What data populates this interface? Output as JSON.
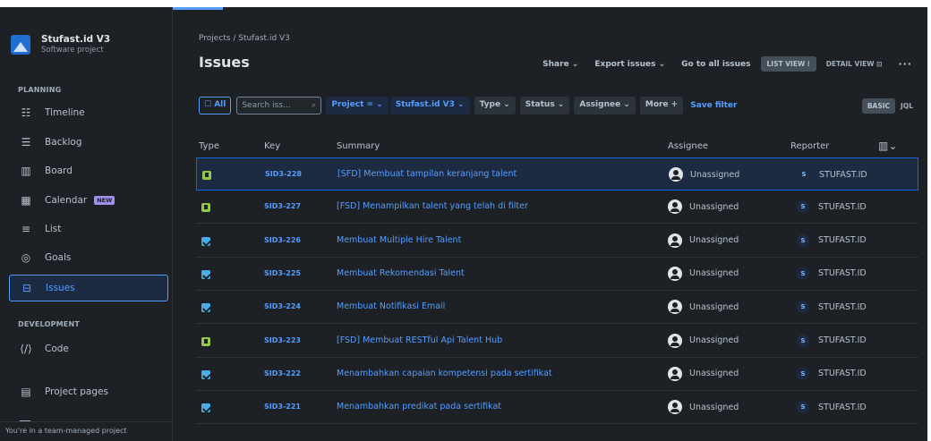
{
  "sidebar": {
    "project_name": "Stufast.id V3",
    "project_type": "Software project",
    "planning_label": "PLANNING",
    "development_label": "DEVELOPMENT",
    "items": [
      {
        "label": "Timeline",
        "icon": "timeline-icon"
      },
      {
        "label": "Backlog",
        "icon": "backlog-icon"
      },
      {
        "label": "Board",
        "icon": "board-icon"
      },
      {
        "label": "Calendar",
        "icon": "calendar-icon",
        "badge": "NEW"
      },
      {
        "label": "List",
        "icon": "list-icon"
      },
      {
        "label": "Goals",
        "icon": "goals-icon"
      },
      {
        "label": "Issues",
        "icon": "issues-icon",
        "active": true
      }
    ],
    "dev_items": [
      {
        "label": "Code",
        "icon": "code-icon"
      }
    ],
    "project_pages": "Project pages",
    "team_note": "You're in a team-managed project"
  },
  "header": {
    "breadcrumb": "Projects / Stufast.id V3",
    "title": "Issues",
    "share": "Share ⌄",
    "export": "Export issues ⌄",
    "go_all": "Go to all issues",
    "list_view": "LIST VIEW ⁝",
    "detail_view": "DETAIL VIEW ⊡",
    "more": "···"
  },
  "filters": {
    "all": "☐ All",
    "search_placeholder": "Search iss...",
    "project": "Project = ⌄",
    "project_value": "Stufast.id V3 ⌄",
    "type": "Type ⌄",
    "status": "Status ⌄",
    "assignee": "Assignee ⌄",
    "more": "More +",
    "save": "Save filter",
    "basic": "BASIC",
    "jql": "JQL"
  },
  "table": {
    "columns": {
      "type": "Type",
      "key": "Key",
      "summary": "Summary",
      "assignee": "Assignee",
      "reporter": "Reporter"
    },
    "rows": [
      {
        "type": "story",
        "key": "SID3-228",
        "summary": "[SFD] Membuat tampilan keranjang talent",
        "assignee": "Unassigned",
        "reporter": "STUFAST.ID",
        "selected": true
      },
      {
        "type": "story",
        "key": "SID3-227",
        "summary": "[FSD] Menampilkan talent yang telah di filter",
        "assignee": "Unassigned",
        "reporter": "STUFAST.ID"
      },
      {
        "type": "task",
        "key": "SID3-226",
        "summary": "Membuat Multiple Hire Talent",
        "assignee": "Unassigned",
        "reporter": "STUFAST.ID"
      },
      {
        "type": "task",
        "key": "SID3-225",
        "summary": "Membuat Rekomendasi Talent",
        "assignee": "Unassigned",
        "reporter": "STUFAST.ID"
      },
      {
        "type": "task",
        "key": "SID3-224",
        "summary": "Membuat Notifikasi Email",
        "assignee": "Unassigned",
        "reporter": "STUFAST.ID"
      },
      {
        "type": "story",
        "key": "SID3-223",
        "summary": "[FSD] Membuat RESTful Api Talent Hub",
        "assignee": "Unassigned",
        "reporter": "STUFAST.ID"
      },
      {
        "type": "task",
        "key": "SID3-222",
        "summary": "Menambahkan capaian kompetensi pada sertifikat",
        "assignee": "Unassigned",
        "reporter": "STUFAST.ID"
      },
      {
        "type": "task",
        "key": "SID3-221",
        "summary": "Menambahkan predikat pada sertifikat",
        "assignee": "Unassigned",
        "reporter": "STUFAST.ID"
      }
    ]
  },
  "colors": {
    "accent": "#579dff",
    "background": "#1d2125",
    "story": "#94c748",
    "task": "#4bade8"
  }
}
